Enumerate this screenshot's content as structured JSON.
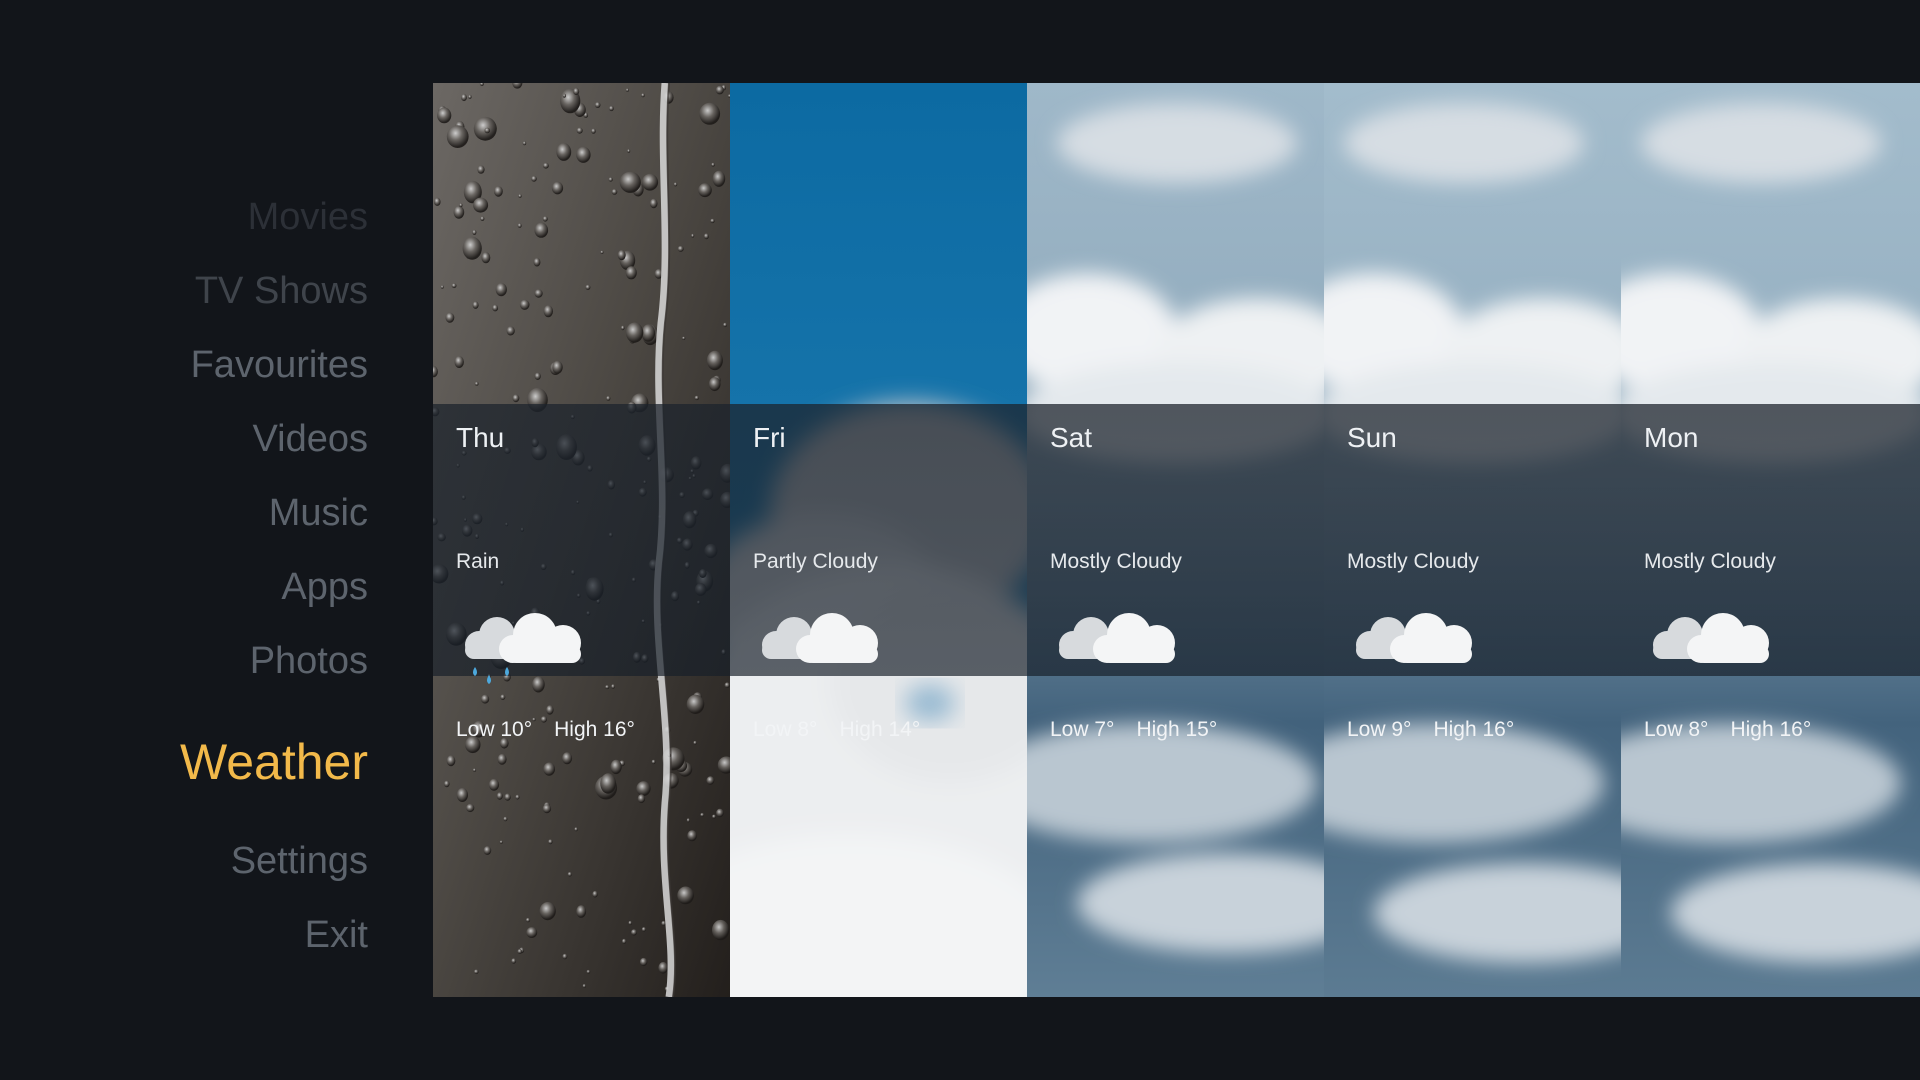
{
  "theme": {
    "background": "#12151a",
    "menu_inactive": "#5d646d",
    "menu_faded": "#2c3037",
    "menu_active": "#f2b94a"
  },
  "menu": {
    "items": [
      {
        "label": "Movies",
        "state": "faded"
      },
      {
        "label": "TV Shows",
        "state": "dim"
      },
      {
        "label": "Favourites",
        "state": "normal"
      },
      {
        "label": "Videos",
        "state": "normal"
      },
      {
        "label": "Music",
        "state": "normal"
      },
      {
        "label": "Apps",
        "state": "normal"
      },
      {
        "label": "Photos",
        "state": "normal"
      },
      {
        "label": "Weather",
        "state": "active"
      },
      {
        "label": "Settings",
        "state": "normal"
      },
      {
        "label": "Exit",
        "state": "normal"
      }
    ]
  },
  "forecast": {
    "days": [
      {
        "day": "Thu",
        "condition": "Rain",
        "low": "Low 10°",
        "high": "High 16°",
        "icon": "rain-cloud-icon",
        "background": "rain-drops"
      },
      {
        "day": "Fri",
        "condition": "Partly Cloudy",
        "low": "Low 8°",
        "high": "High 14°",
        "icon": "cloud-icon",
        "background": "blue-sky-clouds"
      },
      {
        "day": "Sat",
        "condition": "Mostly Cloudy",
        "low": "Low 7°",
        "high": "High 15°",
        "icon": "cloud-icon",
        "background": "cloudy-sky"
      },
      {
        "day": "Sun",
        "condition": "Mostly Cloudy",
        "low": "Low 9°",
        "high": "High 16°",
        "icon": "cloud-icon",
        "background": "cloudy-sky"
      },
      {
        "day": "Mon",
        "condition": "Mostly Cloudy",
        "low": "Low 8°",
        "high": "High 16°",
        "icon": "cloud-icon",
        "background": "cloudy-sky"
      }
    ]
  }
}
